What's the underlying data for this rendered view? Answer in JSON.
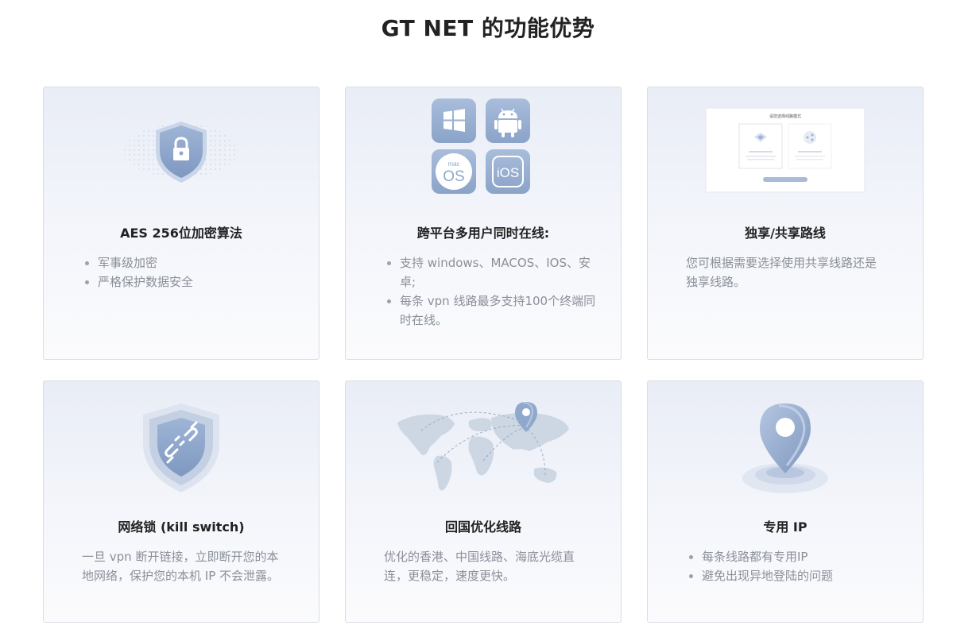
{
  "page": {
    "title": "GT NET 的功能优势"
  },
  "cards": [
    {
      "title": "AES 256位加密算法",
      "bullets": [
        "军事级加密",
        "严格保护数据安全"
      ]
    },
    {
      "title": "跨平台多用户同时在线:",
      "bullets": [
        "支持 windows、MACOS、IOS、安卓;",
        "每条 vpn 线路最多支持100个终端同时在线。"
      ],
      "os_badges": [
        "mac",
        "OS",
        "iOS"
      ]
    },
    {
      "title": "独享/共享路线",
      "text": "您可根据需要选择使用共享线路还是独享线路。",
      "mockup_title": "请您选择线路模式"
    },
    {
      "title": "网络锁 (kill switch)",
      "text": "一旦 vpn 断开链接，立即断开您的本地网络，保护您的本机 IP 不会泄露。"
    },
    {
      "title": "回国优化线路",
      "text": "优化的香港、中国线路、海底光缆直连，更稳定，速度更快。"
    },
    {
      "title": "专用 IP",
      "bullets": [
        "每条线路都有专用IP",
        "避免出现异地登陆的问题"
      ]
    }
  ],
  "icons": {
    "card1": "shield-lock-icon",
    "card2": [
      "windows-icon",
      "android-icon",
      "macos-icon",
      "ios-icon"
    ],
    "card3": "line-select-mockup",
    "card4": "shield-plug-icon",
    "card5": "world-map-icon",
    "card6": "map-pin-icon"
  },
  "colors": {
    "accent": "#8fa8cc",
    "accent_dark": "#7d96bd",
    "text": "#222222",
    "muted": "#8a8f99"
  }
}
